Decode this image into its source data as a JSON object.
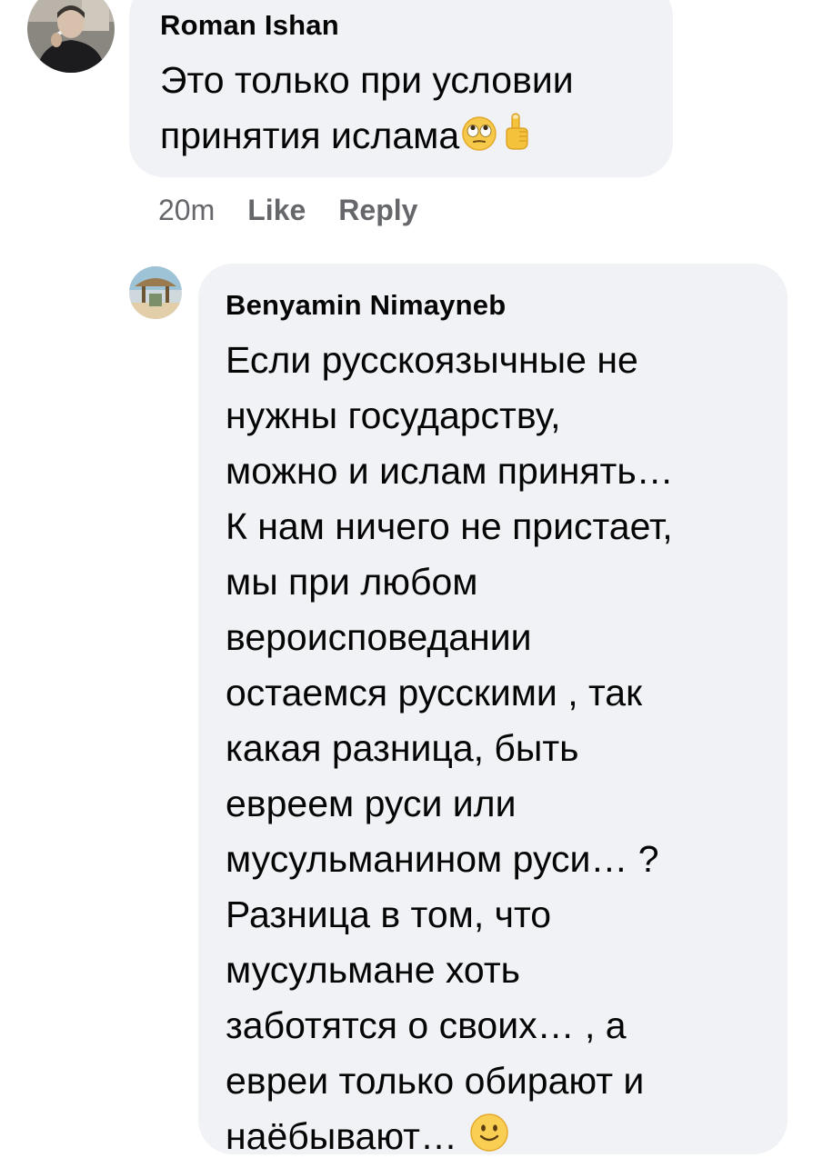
{
  "comment1": {
    "author": "Roman Ishan",
    "text": "Это только при условии\nпринятия ислама",
    "emojis": [
      "face-with-rolling-eyes-emoji",
      "index-pointing-up-emoji"
    ],
    "time": "20m",
    "like_label": "Like",
    "reply_label": "Reply"
  },
  "comment2": {
    "author": "Benyamin Nimayneb",
    "text": "Если русскоязычные не\nнужны государству,\nможно и ислам принять…\nК нам ничего не пристает,\nмы при любом\nвероисповедании\nостаемся русскими , так\nкакая разница, быть\nевреем руси или\nмусульманином руси… ?\nРазница в том, что\nмусульмане хоть\nзаботятся о своих… , а\nевреи только обирают и\nнаёбывают…",
    "emojis": [
      "slightly-smiling-face-emoji"
    ]
  },
  "colors": {
    "bubble": "#f0f2f5",
    "text": "#050505",
    "meta": "#65676b"
  }
}
